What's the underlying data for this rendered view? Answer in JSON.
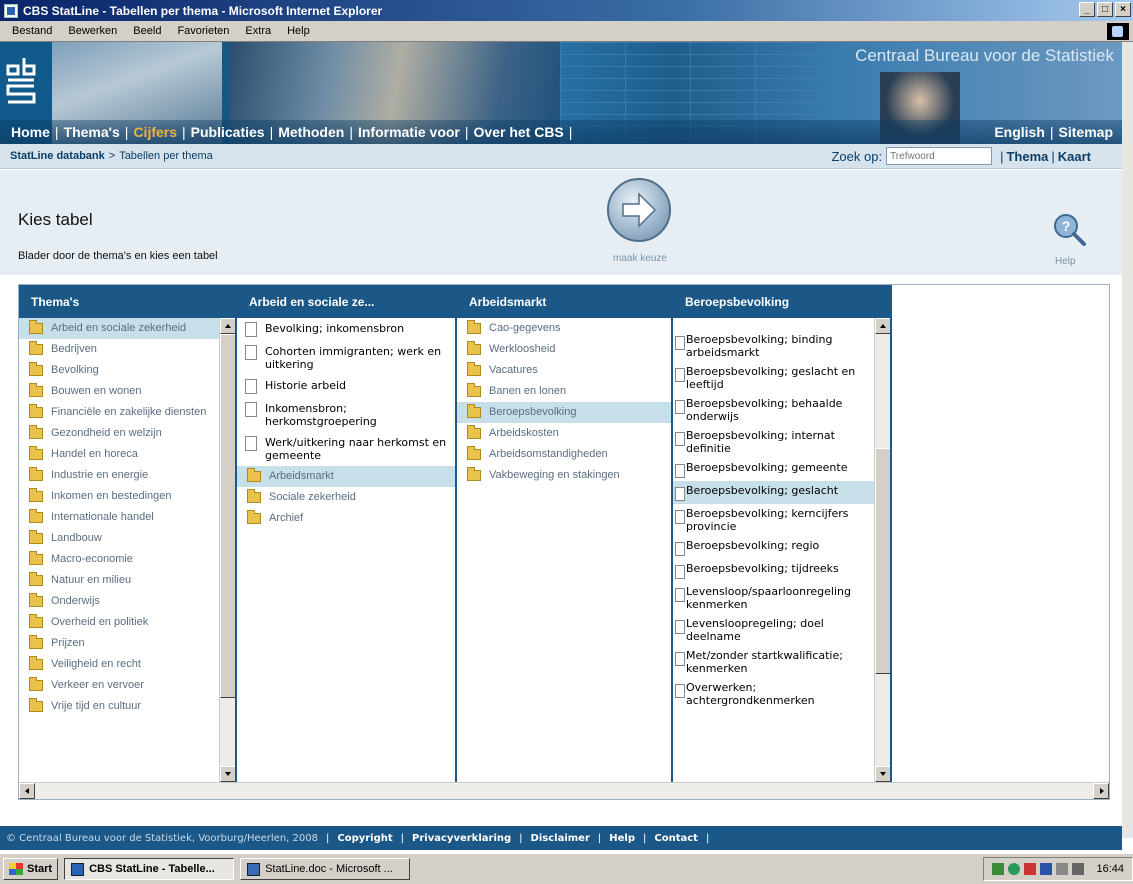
{
  "window": {
    "title": "CBS StatLine - Tabellen per thema - Microsoft Internet Explorer",
    "buttons": [
      "_",
      "×"
    ]
  },
  "menubar": [
    "Bestand",
    "Bewerken",
    "Beeld",
    "Favorieten",
    "Extra",
    "Help"
  ],
  "banner": {
    "brand": "Centraal Bureau voor de Statistiek",
    "nav": [
      "Home",
      "Thema's",
      "Cijfers",
      "Publicaties",
      "Methoden",
      "Informatie voor",
      "Over het CBS"
    ],
    "nav_active": "Cijfers",
    "nav_right": [
      "English",
      "Sitemap"
    ]
  },
  "breadcrumb": {
    "root": "StatLine databank",
    "separator": ">",
    "current": "Tabellen per thema",
    "search_label": "Zoek op:",
    "search_placeholder": "Trefwoord",
    "links": [
      "Thema",
      "Kaart"
    ]
  },
  "header": {
    "title": "Kies tabel",
    "subtitle": "Blader door de thema's en kies een tabel",
    "next_label": "maak keuze",
    "help_label": "Help"
  },
  "columns": {
    "themas": {
      "title": "Thema's",
      "items": [
        "Arbeid en sociale zekerheid",
        "Bedrijven",
        "Bevolking",
        "Bouwen en wonen",
        "Financiële en zakelijke diensten",
        "Gezondheid en welzijn",
        "Handel en horeca",
        "Industrie en energie",
        "Inkomen en bestedingen",
        "Internationale handel",
        "Landbouw",
        "Macro-economie",
        "Natuur en milieu",
        "Onderwijs",
        "Overheid en politiek",
        "Prijzen",
        "Veiligheid en recht",
        "Verkeer en vervoer",
        "Vrije tijd en cultuur"
      ],
      "selected": 0
    },
    "arbeid": {
      "title": "Arbeid en sociale ze...",
      "tables": [
        "Bevolking; inkomensbron",
        "Cohorten immigranten; werk en uitkering",
        "Historie arbeid",
        "Inkomensbron; herkomstgroepering",
        "Werk/uitkering naar herkomst en gemeente"
      ],
      "folders": [
        "Arbeidsmarkt",
        "Sociale zekerheid",
        "Archief"
      ],
      "selected_folder": 0
    },
    "arbeidsmarkt": {
      "title": "Arbeidsmarkt",
      "items": [
        "Cao-gegevens",
        "Werkloosheid",
        "Vacatures",
        "Banen en lonen",
        "Beroepsbevolking",
        "Arbeidskosten",
        "Arbeidsomstandigheden",
        "Vakbeweging en stakingen"
      ],
      "selected": 4
    },
    "beroeps": {
      "title": "Beroepsbevolking",
      "items": [
        "Beroepsbevolking; binding arbeidsmarkt",
        "Beroepsbevolking; geslacht en leeftijd",
        "Beroepsbevolking; behaalde onderwijs",
        "Beroepsbevolking; internat definitie",
        "Beroepsbevolking; gemeente",
        "Beroepsbevolking; geslacht",
        "Beroepsbevolking; kerncijfers provincie",
        "Beroepsbevolking; regio",
        "Beroepsbevolking; tijdreeks",
        "Levensloop/spaarloonregeling kenmerken",
        "Levensloopregeling; doel deelname",
        "Met/zonder startkwalificatie; kenmerken",
        "Overwerken; achtergrondkenmerken"
      ],
      "selected": 5
    }
  },
  "footer": {
    "copyright": "© Centraal Bureau voor de Statistiek, Voorburg/Heerlen, 2008",
    "links": [
      "Copyright",
      "Privacyverklaring",
      "Disclaimer",
      "Help",
      "Contact"
    ]
  },
  "taskbar": {
    "start": "Start",
    "tasks": [
      "CBS StatLine - Tabelle...",
      "StatLine.doc - Microsoft ..."
    ],
    "clock": "16:44"
  }
}
